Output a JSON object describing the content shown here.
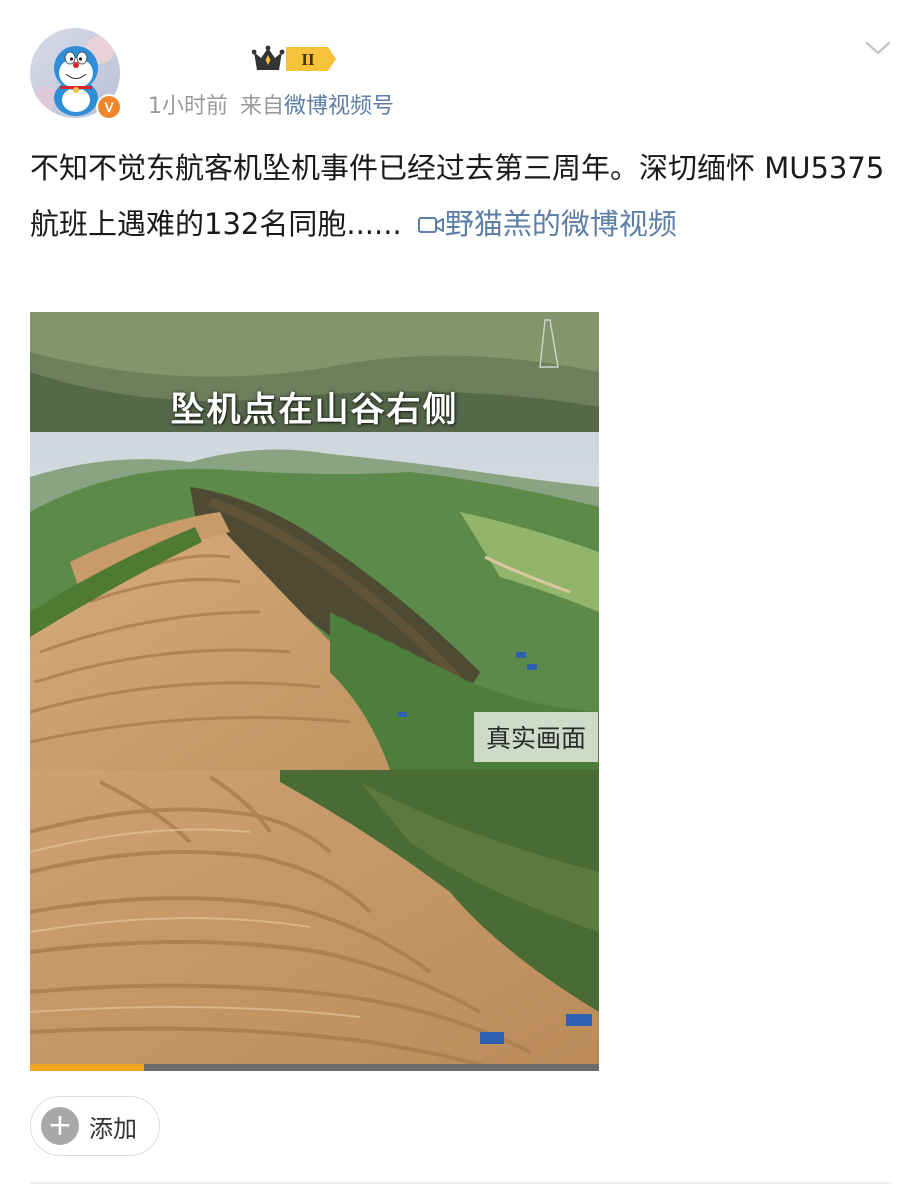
{
  "post": {
    "time": "1小时前",
    "source_prefix": "来自",
    "source": "微博视频号",
    "member_level": "II",
    "verified_mark": "V",
    "text": "不知不觉东航客机坠机事件已经过去第三周年。深切缅怀 MU5375航班上遇难的132名同胞......",
    "video_link": "野猫羔的微博视频",
    "video": {
      "caption_top": "坠机点在山谷右侧",
      "caption_right": "真实画面",
      "progress": 0.2
    },
    "add_label": "添加",
    "add_symbol": "+"
  },
  "icons": [
    "avatar-doraemon-icon",
    "crown-icon",
    "chevron-down-icon",
    "video-camera-icon",
    "plus-icon",
    "verified-icon"
  ],
  "colors": {
    "link": "#5d7ea6",
    "meta": "#9a9a9a",
    "text": "#1a1a1a",
    "verified": "#f0852a",
    "badge_gold": "#f5c23a",
    "progress": "#f0a31e"
  }
}
